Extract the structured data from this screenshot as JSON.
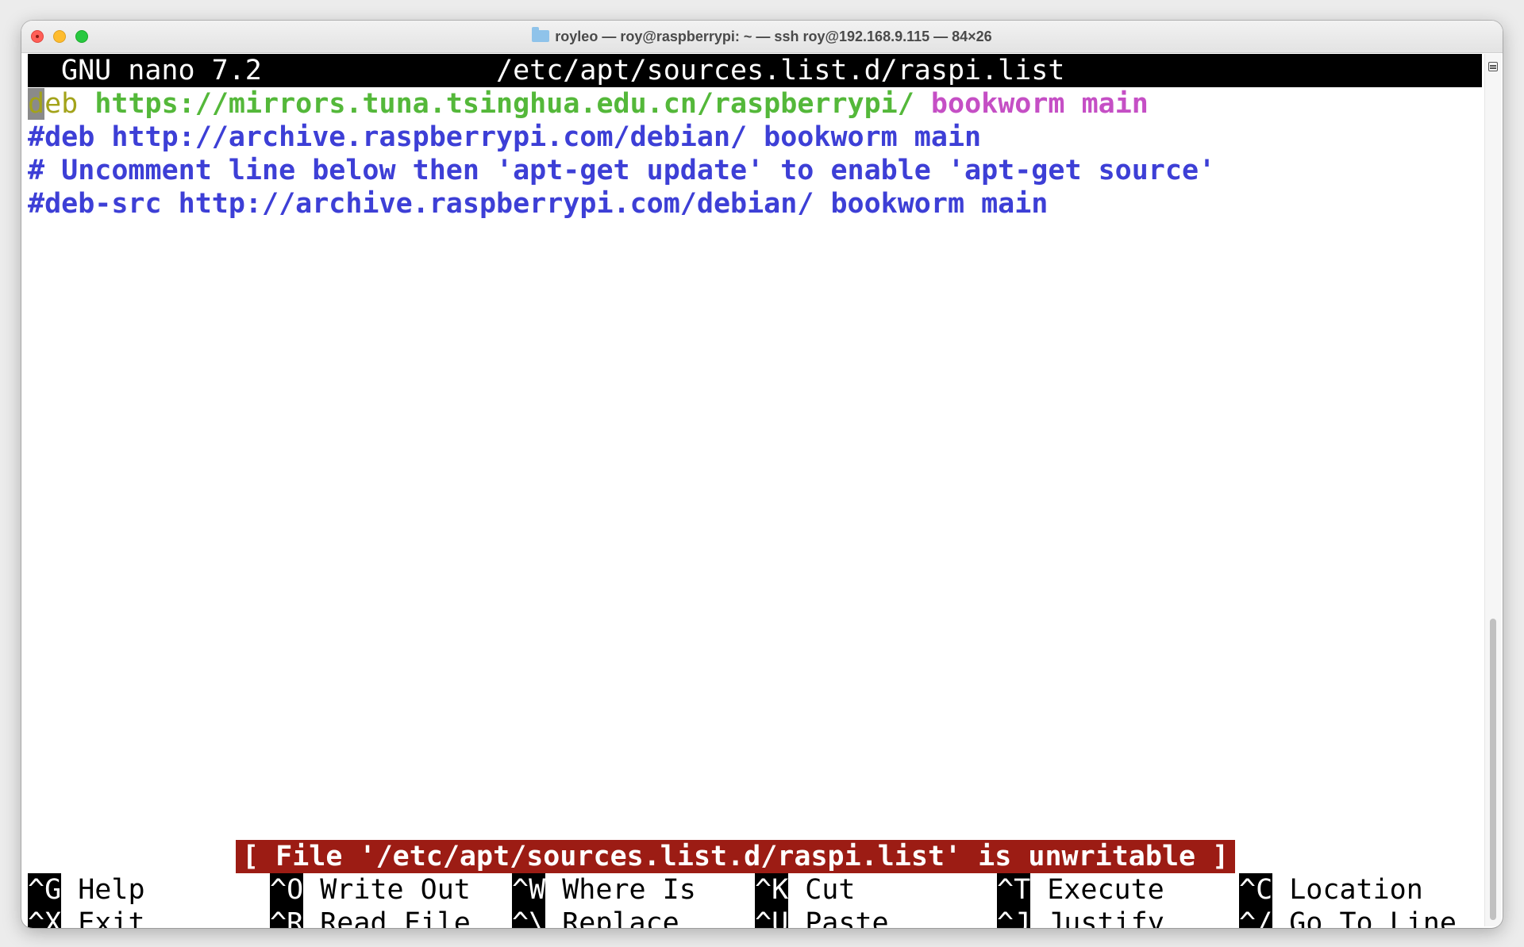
{
  "window": {
    "title": "royleo — roy@raspberrypi: ~ — ssh roy@192.168.9.115 — 84×26"
  },
  "nano": {
    "app_name": "GNU nano 7.2",
    "file_path": "/etc/apt/sources.list.d/raspi.list"
  },
  "lines": [
    {
      "cursor_char": "d",
      "keyword_rest": "eb",
      "url": "https://mirrors.tuna.tsinghua.edu.cn/raspberrypi/",
      "suite": "bookworm main"
    },
    {
      "text": "#deb http://archive.raspberrypi.com/debian/ bookworm main"
    },
    {
      "text": "# Uncomment line below then 'apt-get update' to enable 'apt-get source'"
    },
    {
      "text": "#deb-src http://archive.raspberrypi.com/debian/ bookworm main"
    }
  ],
  "status_message": "[ File '/etc/apt/sources.list.d/raspi.list' is unwritable ]",
  "shortcuts": {
    "row1": [
      {
        "key": "^G",
        "label": "Help"
      },
      {
        "key": "^O",
        "label": "Write Out"
      },
      {
        "key": "^W",
        "label": "Where Is"
      },
      {
        "key": "^K",
        "label": "Cut"
      },
      {
        "key": "^T",
        "label": "Execute"
      },
      {
        "key": "^C",
        "label": "Location"
      }
    ],
    "row2": [
      {
        "key": "^X",
        "label": "Exit"
      },
      {
        "key": "^R",
        "label": "Read File"
      },
      {
        "key": "^\\",
        "label": "Replace"
      },
      {
        "key": "^U",
        "label": "Paste"
      },
      {
        "key": "^J",
        "label": "Justify"
      },
      {
        "key": "^/",
        "label": "Go To Line"
      }
    ]
  },
  "colors": {
    "keyword": "#a3a31a",
    "url": "#54b83a",
    "suite": "#c54fc5",
    "comment": "#3d3fd6",
    "status_bg": "#9c1c14"
  }
}
